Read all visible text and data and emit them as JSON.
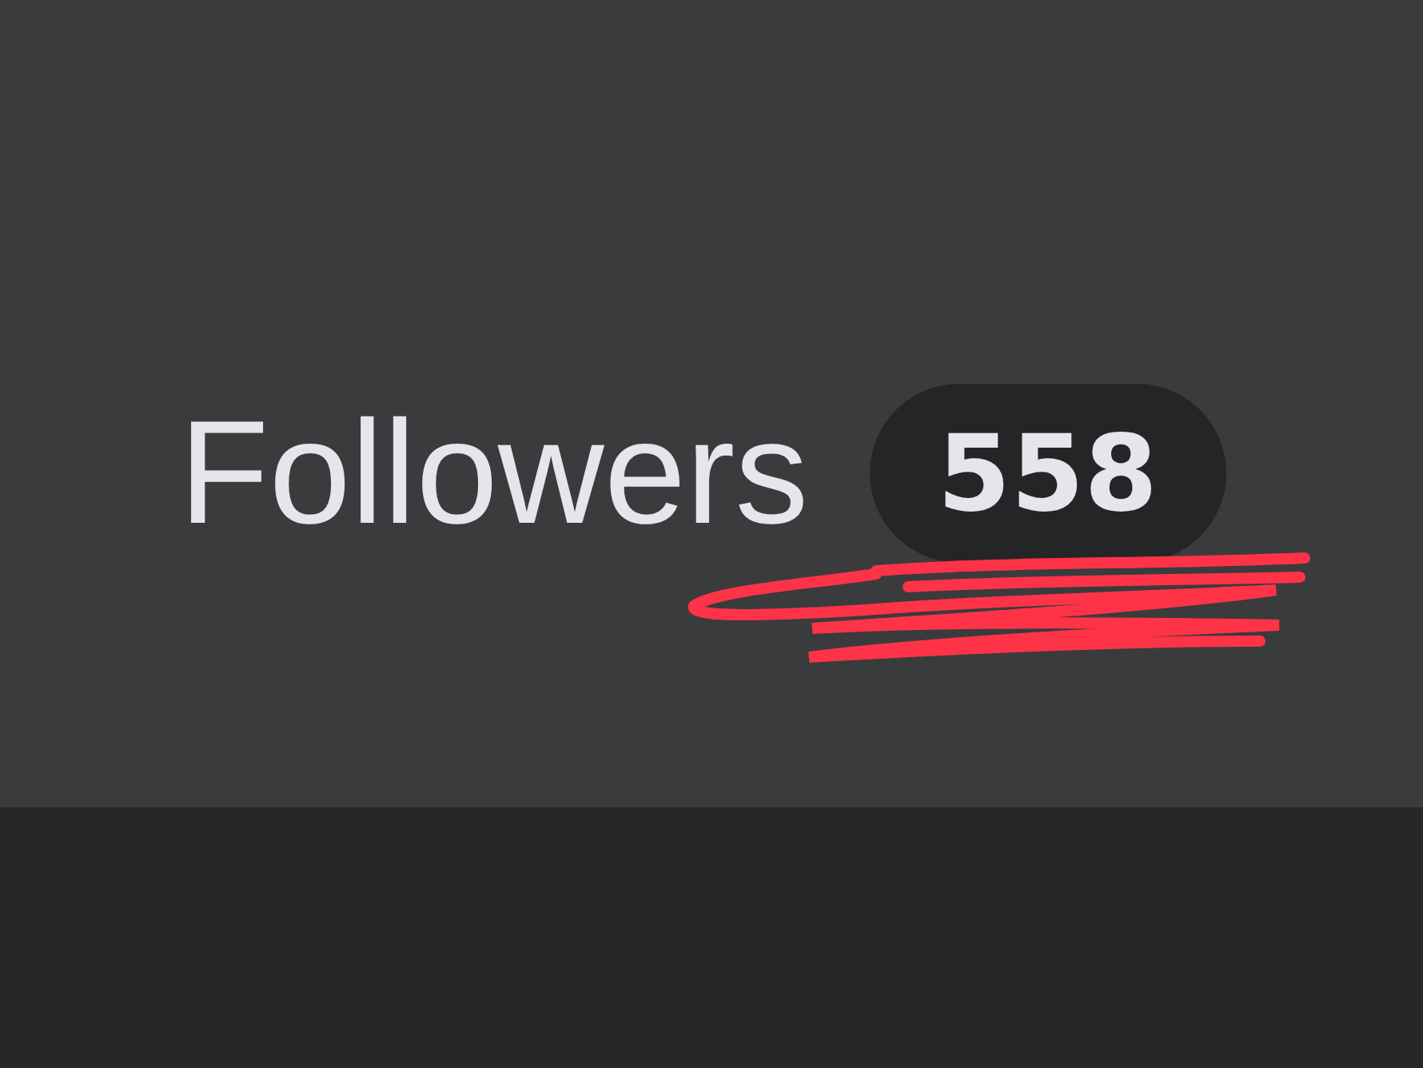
{
  "followers": {
    "label": "Followers",
    "count": "558"
  }
}
